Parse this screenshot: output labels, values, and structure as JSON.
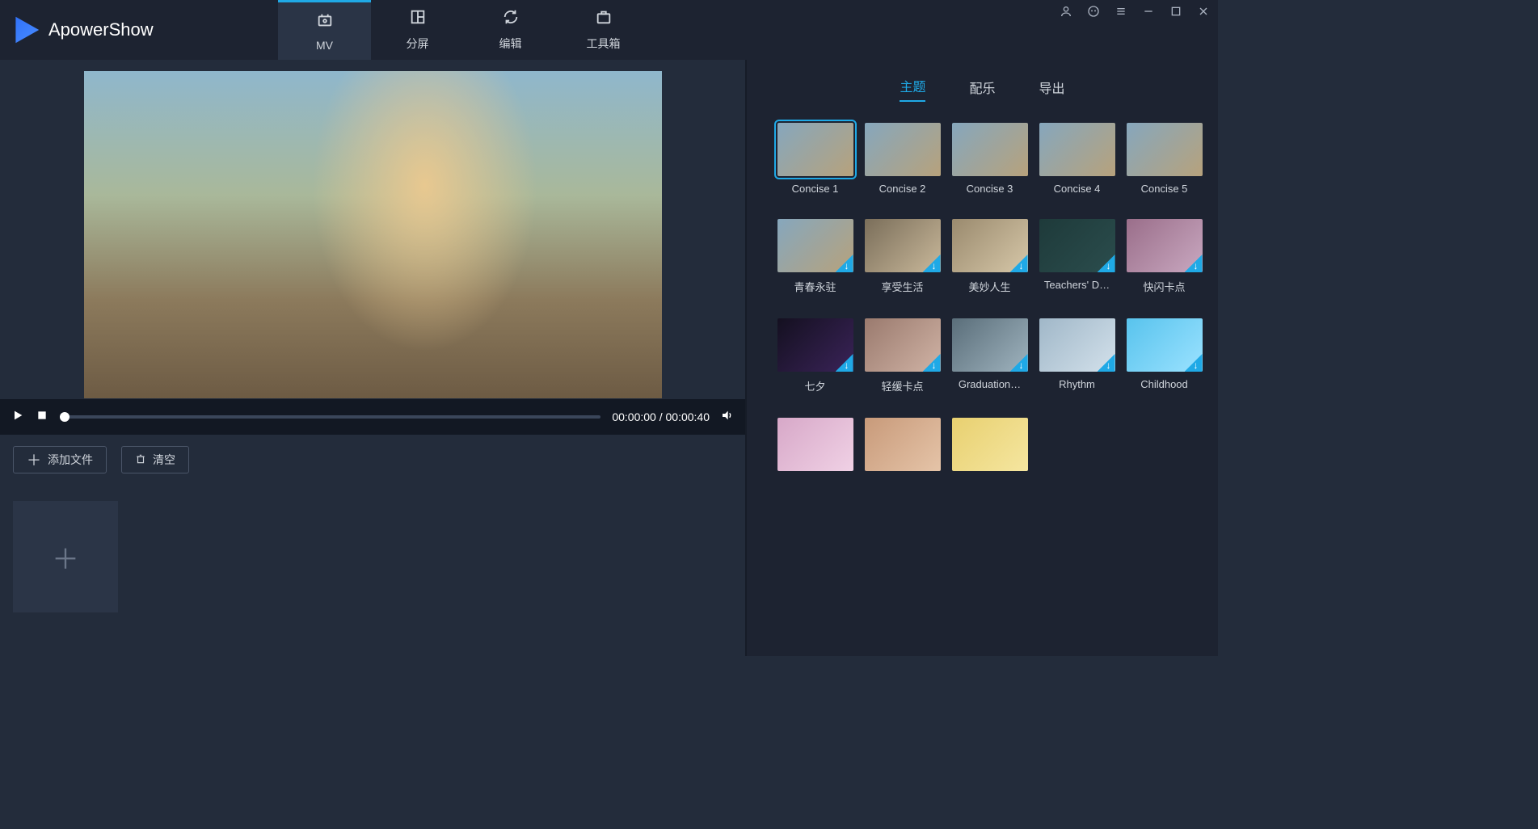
{
  "app": {
    "name": "ApowerShow"
  },
  "nav": {
    "tabs": [
      {
        "label": "MV",
        "active": true
      },
      {
        "label": "分屏",
        "active": false
      },
      {
        "label": "编辑",
        "active": false
      },
      {
        "label": "工具箱",
        "active": false
      }
    ]
  },
  "playback": {
    "current": "00:00:00",
    "total": "00:00:40",
    "separator": " / "
  },
  "toolbar": {
    "add_label": "添加文件",
    "clear_label": "清空"
  },
  "side_tabs": [
    {
      "label": "主题",
      "active": true
    },
    {
      "label": "配乐",
      "active": false
    },
    {
      "label": "导出",
      "active": false
    }
  ],
  "themes": [
    {
      "label": "Concise 1",
      "selected": true,
      "download": false,
      "bg": "linear-gradient(135deg,#86a7bd,#b7a27c)"
    },
    {
      "label": "Concise 2",
      "selected": false,
      "download": false,
      "bg": "linear-gradient(135deg,#86a7bd,#b7a27c)"
    },
    {
      "label": "Concise 3",
      "selected": false,
      "download": false,
      "bg": "linear-gradient(135deg,#86a7bd,#b7a27c)"
    },
    {
      "label": "Concise 4",
      "selected": false,
      "download": false,
      "bg": "linear-gradient(135deg,#86a7bd,#b7a27c)"
    },
    {
      "label": "Concise 5",
      "selected": false,
      "download": false,
      "bg": "linear-gradient(135deg,#86a7bd,#b7a27c)"
    },
    {
      "label": "青春永驻",
      "selected": false,
      "download": true,
      "bg": "linear-gradient(135deg,#86a7bd,#b7a27c)"
    },
    {
      "label": "享受生活",
      "selected": false,
      "download": true,
      "bg": "linear-gradient(135deg,#7a6e5a,#c9b89a)"
    },
    {
      "label": "美妙人生",
      "selected": false,
      "download": true,
      "bg": "linear-gradient(135deg,#9a8a6e,#d6c7a8)"
    },
    {
      "label": "Teachers' D…",
      "selected": false,
      "download": true,
      "bg": "linear-gradient(135deg,#1e3a3a,#2b4d4d)"
    },
    {
      "label": "快闪卡点",
      "selected": false,
      "download": true,
      "bg": "linear-gradient(135deg,#9a6e8a,#c9a8c0)"
    },
    {
      "label": "七夕",
      "selected": false,
      "download": true,
      "bg": "linear-gradient(135deg,#141020,#3a2358)"
    },
    {
      "label": "轻缓卡点",
      "selected": false,
      "download": true,
      "bg": "linear-gradient(135deg,#9a7a6e,#d0b3a5)"
    },
    {
      "label": "Graduation…",
      "selected": false,
      "download": true,
      "bg": "linear-gradient(135deg,#5a6e7a,#9fb3be)"
    },
    {
      "label": "Rhythm",
      "selected": false,
      "download": true,
      "bg": "linear-gradient(135deg,#a0b7c8,#d3e1eb)"
    },
    {
      "label": "Childhood",
      "selected": false,
      "download": true,
      "bg": "linear-gradient(135deg,#58c3ed,#9be2ff)"
    },
    {
      "label": "",
      "selected": false,
      "download": false,
      "bg": "linear-gradient(135deg,#d7a8c8,#f0d1e5)"
    },
    {
      "label": "",
      "selected": false,
      "download": false,
      "bg": "linear-gradient(135deg,#c89a7a,#e5c4a8)"
    },
    {
      "label": "",
      "selected": false,
      "download": false,
      "bg": "linear-gradient(135deg,#e8d070,#f5e6a0)"
    }
  ]
}
